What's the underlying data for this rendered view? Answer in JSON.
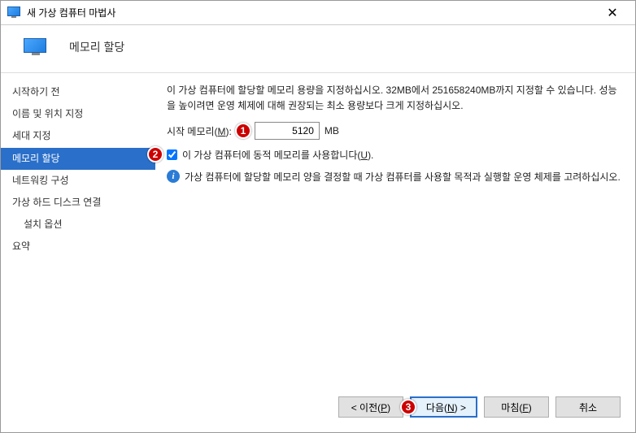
{
  "titlebar": {
    "title": "새 가상 컴퓨터 마법사"
  },
  "header": {
    "title": "메모리 할당"
  },
  "sidebar": {
    "items": [
      {
        "label": "시작하기 전"
      },
      {
        "label": "이름 및 위치 지정"
      },
      {
        "label": "세대 지정"
      },
      {
        "label": "메모리 할당"
      },
      {
        "label": "네트워킹 구성"
      },
      {
        "label": "가상 하드 디스크 연결"
      },
      {
        "label": "설치 옵션"
      },
      {
        "label": "요약"
      }
    ]
  },
  "content": {
    "description": "이 가상 컴퓨터에 할당할 메모리 용량을 지정하십시오. 32MB에서 251658240MB까지 지정할 수 있습니다. 성능을 높이려면 운영 체제에 대해 권장되는 최소 용량보다 크게 지정하십시오.",
    "start_memory_label_pre": "시작 메모리(",
    "start_memory_mnemonic": "M",
    "start_memory_label_post": "):",
    "start_memory_value": "5120",
    "start_memory_unit": "MB",
    "dynamic_memory_label_pre": "이 가상 컴퓨터에 동적 메모리를 사용합니다(",
    "dynamic_memory_mnemonic": "U",
    "dynamic_memory_label_post": ").",
    "dynamic_memory_checked": true,
    "info_text": "가상 컴퓨터에 할당할 메모리 양을 결정할 때 가상 컴퓨터를 사용할 목적과 실행할 운영 체제를 고려하십시오."
  },
  "markers": {
    "m1": "1",
    "m2": "2",
    "m3": "3"
  },
  "footer": {
    "prev_pre": "< 이전(",
    "prev_m": "P",
    "prev_post": ")",
    "next_pre": "다음(",
    "next_m": "N",
    "next_post": ") >",
    "finish_pre": "마침(",
    "finish_m": "F",
    "finish_post": ")",
    "cancel": "취소"
  }
}
